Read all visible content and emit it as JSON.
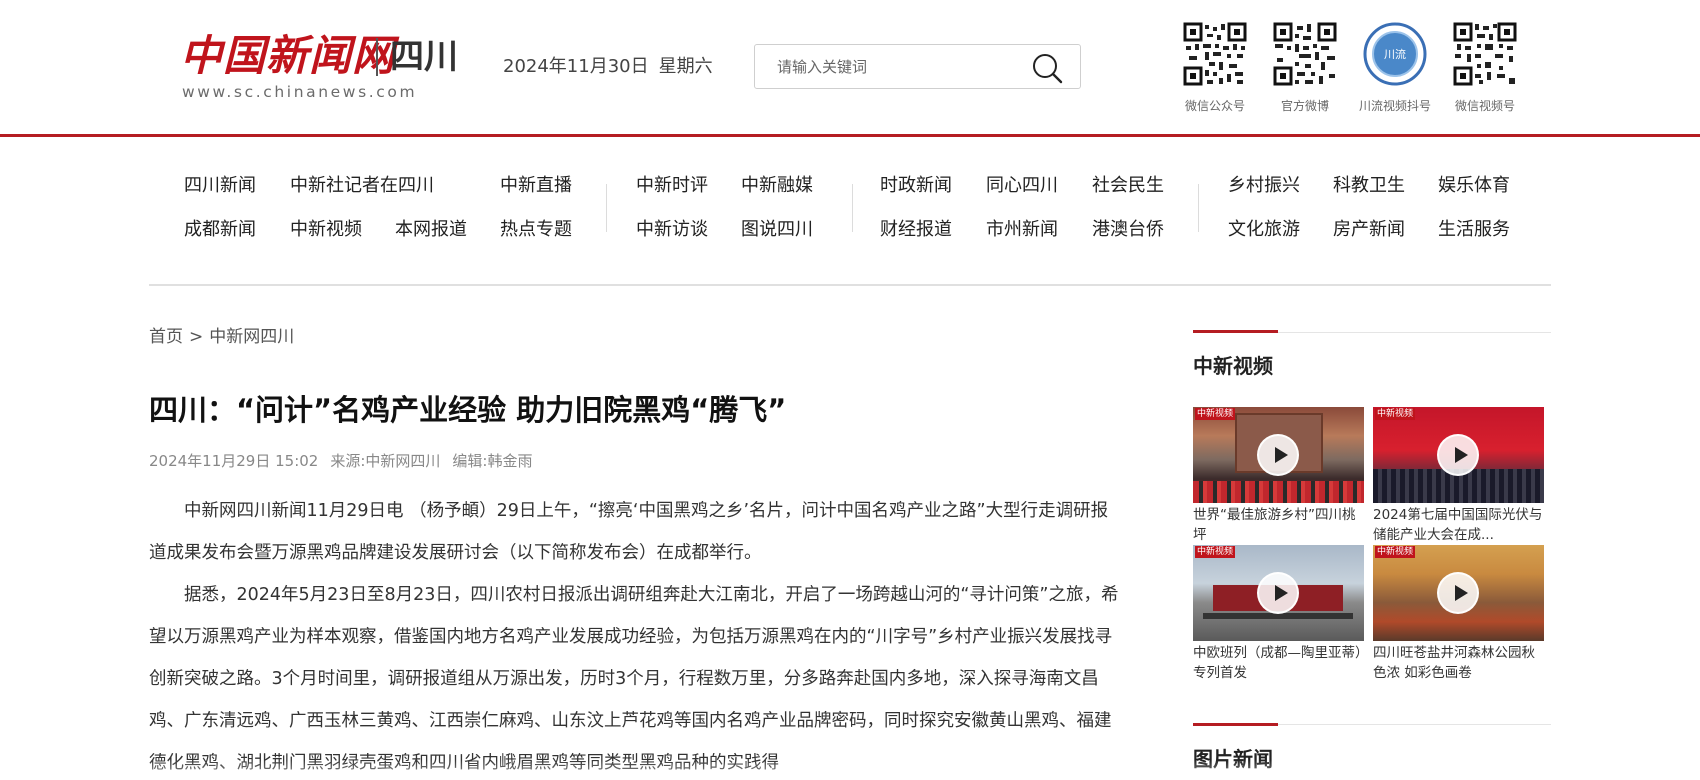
{
  "header": {
    "logo_cn": "中国新闻网",
    "logo_region": "四川",
    "logo_url": "www.sc.chinanews.com",
    "date": "2024年11月30日",
    "weekday": "星期六",
    "search_placeholder": "请输入关键词",
    "qr_codes": [
      {
        "label": "微信公众号"
      },
      {
        "label": "官方微博"
      },
      {
        "label": "川流视频抖号"
      },
      {
        "label": "微信视频号"
      }
    ]
  },
  "nav": {
    "row1": [
      "四川新闻",
      "中新社记者在四川",
      "中新直播",
      "中新时评",
      "中新融媒",
      "时政新闻",
      "同心四川",
      "社会民生",
      "乡村振兴",
      "科教卫生",
      "娱乐体育"
    ],
    "row2": [
      "成都新闻",
      "中新视频",
      "本网报道",
      "热点专题",
      "中新访谈",
      "图说四川",
      "财经报道",
      "市州新闻",
      "港澳台侨",
      "文化旅游",
      "房产新闻",
      "生活服务"
    ]
  },
  "breadcrumb": {
    "home": "首页",
    "separator": ">",
    "section": "中新网四川"
  },
  "article": {
    "title": "四川：“问计”名鸡产业经验 助力旧院黑鸡“腾飞”",
    "datetime": "2024年11月29日 15:02",
    "source": "来源:中新网四川",
    "editor": "编辑:韩金雨",
    "paragraphs": [
      "中新网四川新闻11月29日电 （杨予頔）29日上午，“擦亮‘中国黑鸡之乡’名片，问计中国名鸡产业之路”大型行走调研报道成果发布会暨万源黑鸡品牌建设发展研讨会（以下简称发布会）在成都举行。",
      "据悉，2024年5月23日至8月23日，四川农村日报派出调研组奔赴大江南北，开启了一场跨越山河的“寻计问策”之旅，希望以万源黑鸡产业为样本观察，借鉴国内地方名鸡产业发展成功经验，为包括万源黑鸡在内的“川字号”乡村产业振兴发展找寻创新突破之路。3个月时间里，调研报道组从万源出发，历时3个月，行程数万里，分多路奔赴国内多地，深入探寻海南文昌鸡、广东清远鸡、广西玉林三黄鸡、江西崇仁麻鸡、山东汶上芦花鸡等国内名鸡产业品牌密码，同时探究安徽黄山黑鸡、福建德化黑鸡、湖北荆门黑羽绿壳蛋鸡和四川省内峨眉黑鸡等同类型黑鸡品种的实践得"
    ]
  },
  "sidebar": {
    "video_title": "中新视频",
    "videos": [
      {
        "caption": "世界“最佳旅游乡村”四川桃坪",
        "tag": "中新视频"
      },
      {
        "caption": "2024第七届中国国际光伏与储能产业大会在成...",
        "tag": "中新视频"
      },
      {
        "caption": "中欧班列（成都—陶里亚蒂）专列首发",
        "tag": "中新视频"
      },
      {
        "caption": "四川旺苍盐井河森林公园秋色浓 如彩色画卷",
        "tag": "中新视频"
      }
    ],
    "photo_title": "图片新闻"
  },
  "colors": {
    "brand_red": "#b51c22",
    "logo_red": "#c0141c"
  }
}
